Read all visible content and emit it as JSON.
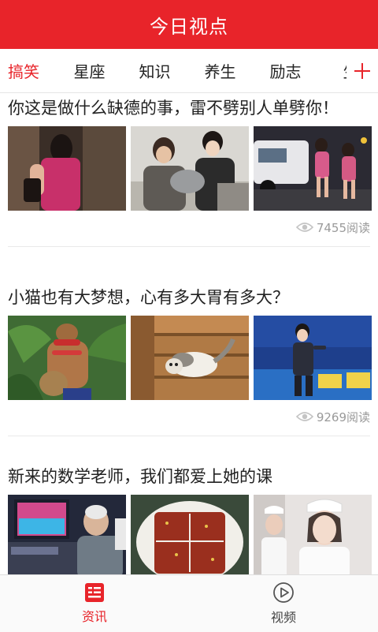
{
  "header": {
    "title": "今日视点"
  },
  "tabs": [
    {
      "label": "搞笑",
      "active": true
    },
    {
      "label": "星座",
      "active": false
    },
    {
      "label": "知识",
      "active": false
    },
    {
      "label": "养生",
      "active": false
    },
    {
      "label": "励志",
      "active": false
    },
    {
      "label": "生",
      "active": false
    }
  ],
  "tab_add_icon": "plus-icon",
  "articles": [
    {
      "title": "你这是做什么缺德的事，雷不劈别人单劈你！",
      "reads": "7455阅读",
      "thumbnails": [
        "woman-in-doorway-photo",
        "women-holding-cat-photo",
        "women-near-police-car-photo"
      ]
    },
    {
      "title": "小猫也有大梦想，心有多大胃有多大？",
      "reads": "9269阅读",
      "thumbnails": [
        "man-with-coconut-photo",
        "cat-on-stairs-photo",
        "singer-on-stage-photo"
      ]
    },
    {
      "title": "新来的数学老师，我们都爱上她的课",
      "reads": "",
      "thumbnails": [
        "man-at-arcade-photo",
        "food-slices-photo",
        "nurses-photo"
      ]
    }
  ],
  "bottom_nav": [
    {
      "label": "资讯",
      "icon": "news-icon",
      "active": true
    },
    {
      "label": "视频",
      "icon": "play-circle-icon",
      "active": false
    }
  ],
  "colors": {
    "accent": "#e8242a",
    "muted": "#9a9a9a"
  }
}
